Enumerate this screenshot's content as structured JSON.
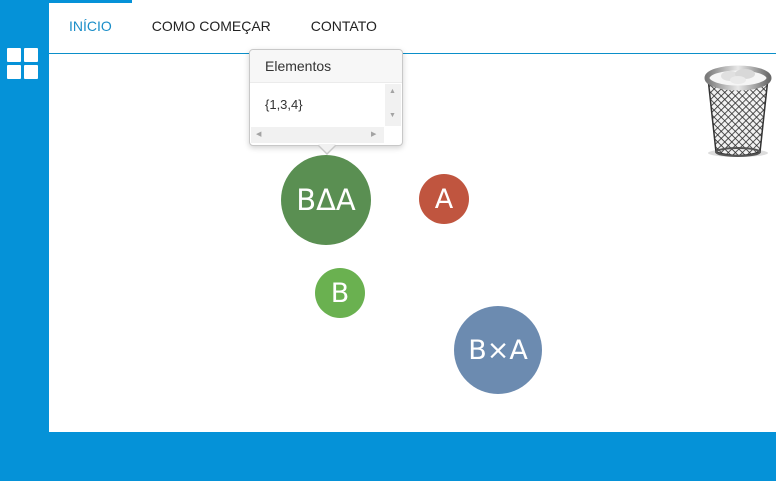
{
  "nav": {
    "items": [
      {
        "label": "INÍCIO",
        "active": true
      },
      {
        "label": "COMO COMEÇAR",
        "active": false
      },
      {
        "label": "CONTATO",
        "active": false
      }
    ]
  },
  "sidebar": {
    "menu_icon": "grid-icon"
  },
  "popover": {
    "title": "Elementos",
    "value": "{1,3,4}"
  },
  "nodes": {
    "b_delta_a": {
      "label": "BΔA",
      "color": "#5a8f52"
    },
    "a": {
      "label": "A",
      "color": "#c0553f"
    },
    "b": {
      "label": "B",
      "color": "#6ab150"
    },
    "b_times_a": {
      "label": "B×A",
      "color": "#6c8bb0"
    }
  },
  "trash": {
    "icon": "trash-can-icon"
  },
  "colors": {
    "frame": "#0592d8",
    "nav_active": "#1b8ec8"
  }
}
